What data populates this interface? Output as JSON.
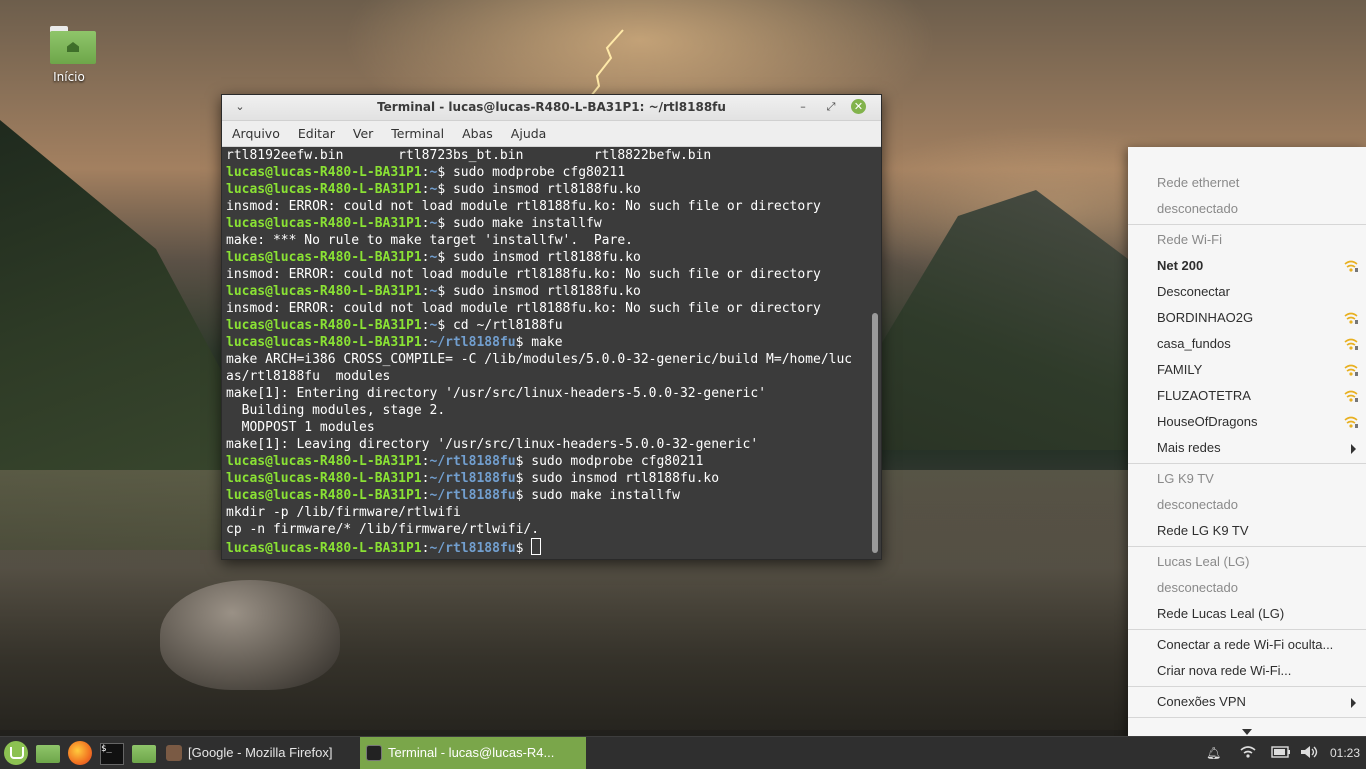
{
  "desktop": {
    "icon_label": "Início"
  },
  "terminal": {
    "title": "Terminal - lucas@lucas-R480-L-BA31P1: ~/rtl8188fu",
    "menu": [
      "Arquivo",
      "Editar",
      "Ver",
      "Terminal",
      "Abas",
      "Ajuda"
    ],
    "lines": [
      {
        "t": "out",
        "text": "rtl8192eefw.bin       rtl8723bs_bt.bin         rtl8822befw.bin"
      },
      {
        "t": "prompt",
        "user": "lucas@lucas-R480-L-BA31P1",
        "path": "~",
        "cmd": " sudo modprobe cfg80211"
      },
      {
        "t": "prompt",
        "user": "lucas@lucas-R480-L-BA31P1",
        "path": "~",
        "cmd": " sudo insmod rtl8188fu.ko"
      },
      {
        "t": "out",
        "text": "insmod: ERROR: could not load module rtl8188fu.ko: No such file or directory"
      },
      {
        "t": "prompt",
        "user": "lucas@lucas-R480-L-BA31P1",
        "path": "~",
        "cmd": " sudo make installfw"
      },
      {
        "t": "out",
        "text": "make: *** No rule to make target 'installfw'.  Pare."
      },
      {
        "t": "prompt",
        "user": "lucas@lucas-R480-L-BA31P1",
        "path": "~",
        "cmd": " sudo insmod rtl8188fu.ko"
      },
      {
        "t": "out",
        "text": "insmod: ERROR: could not load module rtl8188fu.ko: No such file or directory"
      },
      {
        "t": "prompt",
        "user": "lucas@lucas-R480-L-BA31P1",
        "path": "~",
        "cmd": " sudo insmod rtl8188fu.ko"
      },
      {
        "t": "out",
        "text": "insmod: ERROR: could not load module rtl8188fu.ko: No such file or directory"
      },
      {
        "t": "prompt",
        "user": "lucas@lucas-R480-L-BA31P1",
        "path": "~",
        "cmd": " cd ~/rtl8188fu"
      },
      {
        "t": "prompt",
        "user": "lucas@lucas-R480-L-BA31P1",
        "path": "~/rtl8188fu",
        "cmd": " make"
      },
      {
        "t": "out",
        "text": "make ARCH=i386 CROSS_COMPILE= -C /lib/modules/5.0.0-32-generic/build M=/home/luc"
      },
      {
        "t": "out",
        "text": "as/rtl8188fu  modules"
      },
      {
        "t": "out",
        "text": "make[1]: Entering directory '/usr/src/linux-headers-5.0.0-32-generic'"
      },
      {
        "t": "out",
        "text": "  Building modules, stage 2."
      },
      {
        "t": "out",
        "text": "  MODPOST 1 modules"
      },
      {
        "t": "out",
        "text": "make[1]: Leaving directory '/usr/src/linux-headers-5.0.0-32-generic'"
      },
      {
        "t": "prompt",
        "user": "lucas@lucas-R480-L-BA31P1",
        "path": "~/rtl8188fu",
        "cmd": " sudo modprobe cfg80211"
      },
      {
        "t": "prompt",
        "user": "lucas@lucas-R480-L-BA31P1",
        "path": "~/rtl8188fu",
        "cmd": " sudo insmod rtl8188fu.ko"
      },
      {
        "t": "prompt",
        "user": "lucas@lucas-R480-L-BA31P1",
        "path": "~/rtl8188fu",
        "cmd": " sudo make installfw"
      },
      {
        "t": "out",
        "text": "mkdir -p /lib/firmware/rtlwifi"
      },
      {
        "t": "out",
        "text": "cp -n firmware/* /lib/firmware/rtlwifi/."
      },
      {
        "t": "prompt",
        "user": "lucas@lucas-R480-L-BA31P1",
        "path": "~/rtl8188fu",
        "cmd": " ",
        "cursor": true
      }
    ]
  },
  "network_menu": {
    "ethernet_heading": "Rede ethernet",
    "ethernet_status": "desconectado",
    "wifi_heading": "Rede Wi-Fi",
    "wifi_connected": "Net 200",
    "disconnect": "Desconectar",
    "networks": [
      "BORDINHAO2G",
      "casa_fundos",
      "FAMILY",
      "FLUZAOTETRA",
      "HouseOfDragons"
    ],
    "more_networks": "Mais redes",
    "lgk9_heading": "LG K9 TV",
    "lgk9_status": "desconectado",
    "lgk9_network": "Rede LG K9 TV",
    "lucas_heading": "Lucas Leal (LG)",
    "lucas_status": "desconectado",
    "lucas_network": "Rede Lucas Leal (LG)",
    "connect_hidden": "Conectar a rede Wi-Fi oculta...",
    "create_new": "Criar nova rede Wi-Fi...",
    "vpn": "Conexões VPN"
  },
  "panel": {
    "task_firefox": "[Google - Mozilla Firefox]",
    "task_terminal": "Terminal - lucas@lucas-R4...",
    "clock": "01:23",
    "term_icon_glyph": "$_"
  },
  "colors": {
    "prompt_user": "#8ae234",
    "prompt_path": "#729fcf",
    "active_task": "#7aa64a",
    "close_button": "#82b34c"
  }
}
